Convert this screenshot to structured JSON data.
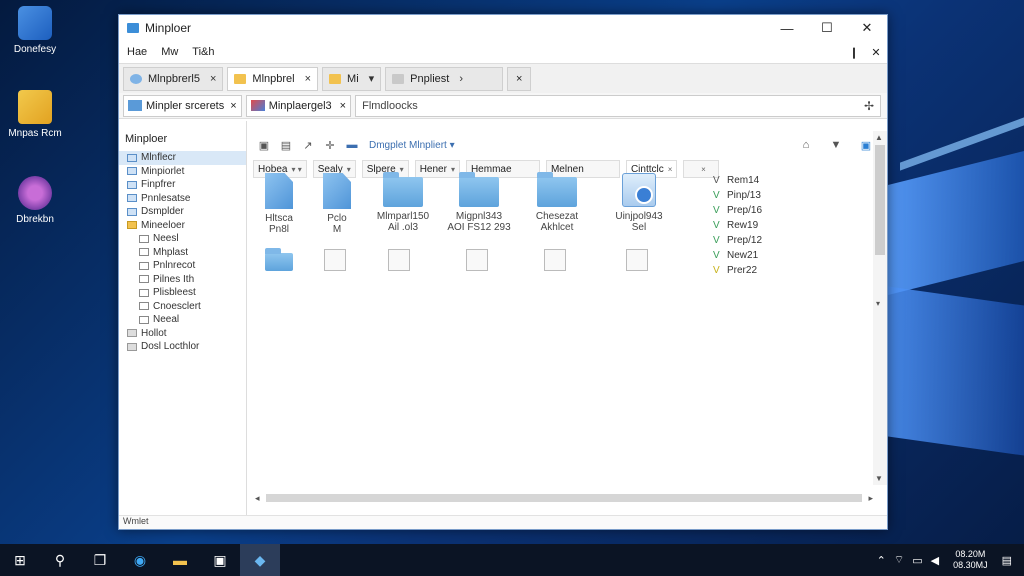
{
  "desktop": {
    "icons": [
      {
        "label": "Donefesy"
      },
      {
        "label": "Mnpas Rcm"
      },
      {
        "label": "Dbrekbn"
      }
    ]
  },
  "window": {
    "title": "Minploer",
    "menu": [
      "Hae",
      "Mw",
      "Ti&h"
    ],
    "tabs": [
      {
        "label": "Mlnpbrerl5",
        "close": "×"
      },
      {
        "label": "Mlnpbrel",
        "close": "×"
      },
      {
        "label": "Mi",
        "close": "▾"
      },
      {
        "label": "Pnpliest",
        "close": "›"
      }
    ],
    "tabs_close": "×",
    "address_tabs": [
      {
        "label": "Minpler srcerets",
        "close": "×"
      },
      {
        "label": "Minplaergel3",
        "close": "×"
      }
    ],
    "address_text": "Flmdloocks",
    "pin_icon": "pin-icon"
  },
  "sidebar": {
    "title": "Minploer",
    "items": [
      {
        "label": "Mlnflecr",
        "level": 1,
        "selected": true
      },
      {
        "label": "Minpiorlet",
        "level": 1
      },
      {
        "label": "Finpfrer",
        "level": 1
      },
      {
        "label": "Pnnlesatse",
        "level": 1
      },
      {
        "label": "Dsmplder",
        "level": 1
      },
      {
        "label": "Mineeloer",
        "level": 1,
        "yellow": true
      },
      {
        "label": "Neesl",
        "level": 2
      },
      {
        "label": "Mhplast",
        "level": 2
      },
      {
        "label": "Pnlnrecot",
        "level": 2
      },
      {
        "label": "Pilnes Ith",
        "level": 2
      },
      {
        "label": "Plisbleest",
        "level": 2
      },
      {
        "label": "Cnoesclert",
        "level": 2
      },
      {
        "label": "Neeal",
        "level": 2
      },
      {
        "label": "Hollot",
        "level": 1
      },
      {
        "label": "Dosl Locthlor",
        "level": 1
      }
    ]
  },
  "toolbar": {
    "label": "Dmgplet Mlnpliert ▾"
  },
  "columns": [
    {
      "label": "Hobea",
      "dd": "▾ ▾"
    },
    {
      "label": "Sealy",
      "dd": "▾"
    },
    {
      "label": "Slpere",
      "dd": "▾"
    },
    {
      "label": "Hener",
      "dd": "▾"
    },
    {
      "label": "Hemmae",
      "dd": ""
    },
    {
      "label": "Melnen",
      "dd": ""
    },
    {
      "label": "Cinttclc",
      "dd": "×"
    },
    {
      "label": "",
      "dd": "×"
    }
  ],
  "items": [
    {
      "name": "Hltsca",
      "sub": "Pn8l",
      "icon": "file"
    },
    {
      "name": "Pclo",
      "sub": "M",
      "icon": "file"
    },
    {
      "name": "Mlmparl150",
      "sub": "Ail .ol3",
      "icon": "folder"
    },
    {
      "name": "Migpnl343",
      "sub": "AOI FS12 293",
      "icon": "folder"
    },
    {
      "name": "Chesezat",
      "sub": "Akhlcet",
      "icon": "folder"
    },
    {
      "name": "Uinjpol943",
      "sub": "Sel",
      "icon": "app"
    }
  ],
  "second_row_icons": [
    "folder-small",
    "doc",
    "doc",
    "doc",
    "doc",
    "doc"
  ],
  "rightlist": [
    {
      "label": "Rem14",
      "mark": "V"
    },
    {
      "label": "Pinp/13",
      "mark": "V"
    },
    {
      "label": "Prep/16",
      "mark": "V"
    },
    {
      "label": "Rew19",
      "mark": "V"
    },
    {
      "label": "Prep/12",
      "mark": "V"
    },
    {
      "label": "New21",
      "mark": "V"
    },
    {
      "label": "Prer22",
      "mark": "V",
      "yellow": true
    }
  ],
  "status": {
    "text": "Wmlet"
  },
  "taskbar": {
    "clock_time": "08.20M",
    "clock_date": "08.30MJ"
  }
}
